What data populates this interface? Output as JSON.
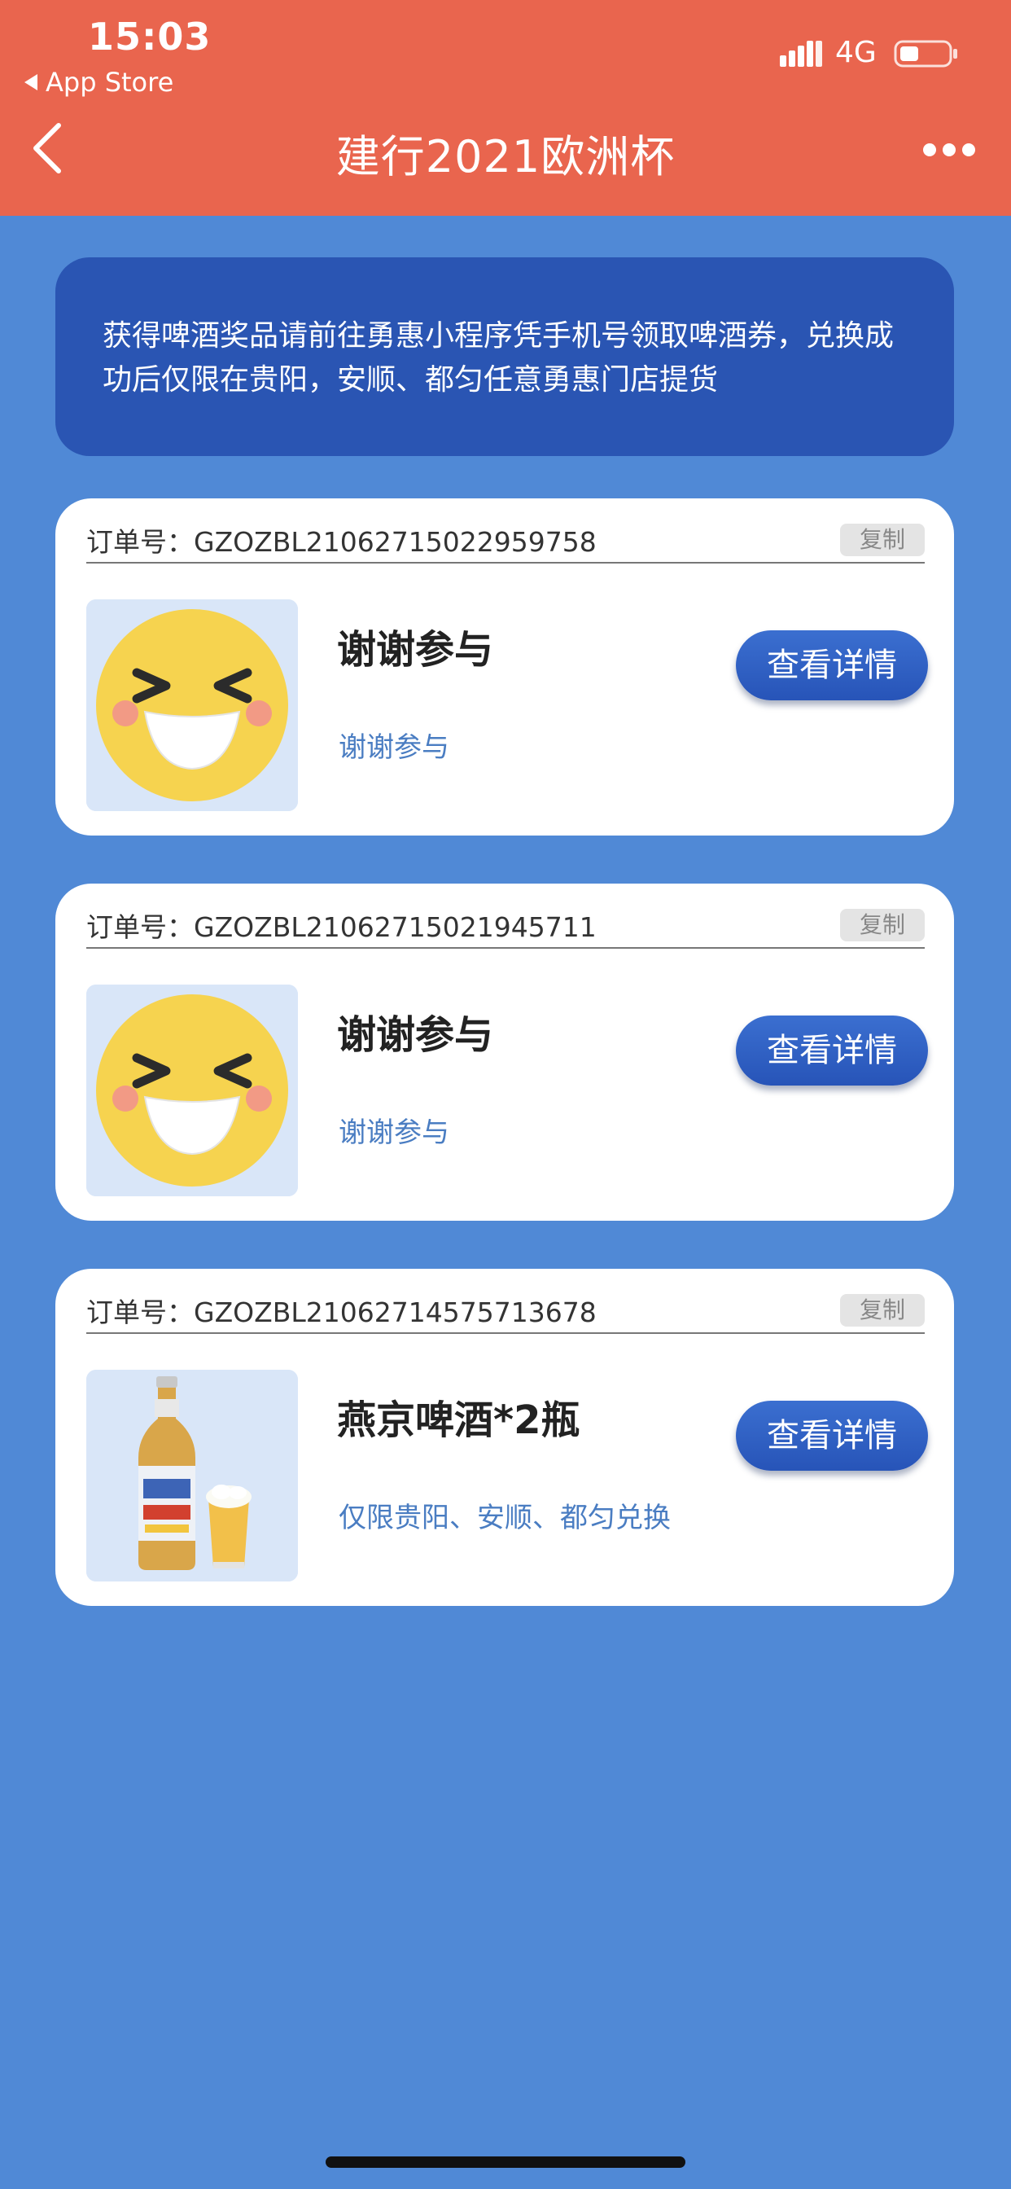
{
  "status_bar": {
    "time": "15:03",
    "back_app": "App Store",
    "network": "4G"
  },
  "nav": {
    "title": "建行2021欧洲杯"
  },
  "notice": {
    "text": "获得啤酒奖品请前往勇惠小程序凭手机号领取啤酒券，兑换成功后仅限在贵阳，安顺、都匀任意勇惠门店提货"
  },
  "orders": [
    {
      "order_no": "订单号：GZOZBL21062715022959758",
      "copy_label": "复制",
      "prize_name": "谢谢参与",
      "prize_desc": "谢谢参与",
      "detail_label": "查看详情",
      "icon": "laughing-emoji-icon"
    },
    {
      "order_no": "订单号：GZOZBL21062715021945711",
      "copy_label": "复制",
      "prize_name": "谢谢参与",
      "prize_desc": "谢谢参与",
      "detail_label": "查看详情",
      "icon": "laughing-emoji-icon"
    },
    {
      "order_no": "订单号：GZOZBL21062714575713678",
      "copy_label": "复制",
      "prize_name": "燕京啤酒*2瓶",
      "prize_desc": "仅限贵阳、安顺、都匀兑换",
      "detail_label": "查看详情",
      "icon": "beer-bottle-icon"
    }
  ],
  "colors": {
    "header": "#e9654e",
    "background": "#5089d6",
    "notice": "#2a55b3",
    "button": "#2754b8",
    "desc_text": "#4a7dc2"
  }
}
